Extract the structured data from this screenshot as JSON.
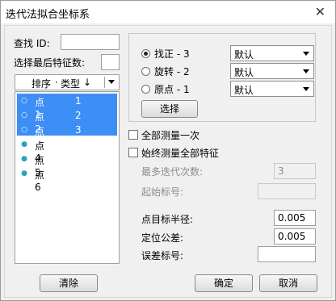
{
  "window": {
    "title": "迭代法拟合坐标系",
    "close": "✕"
  },
  "find": {
    "id_label": "查找 ID:",
    "id_value": "",
    "last_features_label": "选择最后特征数:",
    "last_features_value": ""
  },
  "list": {
    "header": {
      "col1": "排序",
      "col2": "类型",
      "sort_indicator": "↓"
    },
    "items": [
      {
        "name": "点1",
        "type": "1",
        "selected": true,
        "marker": "○"
      },
      {
        "name": "点2",
        "type": "2",
        "selected": true,
        "marker": "○"
      },
      {
        "name": "点3",
        "type": "3",
        "selected": true,
        "marker": "○"
      },
      {
        "name": "点4",
        "type": "",
        "selected": false,
        "marker": "●"
      },
      {
        "name": "点5",
        "type": "",
        "selected": false,
        "marker": "●"
      },
      {
        "name": "点6",
        "type": "",
        "selected": false,
        "marker": "●"
      }
    ]
  },
  "axes": {
    "options": [
      {
        "label": "找正 - 3",
        "selected": true,
        "combo": "默认"
      },
      {
        "label": "旋转 - 2",
        "selected": false,
        "combo": "默认"
      },
      {
        "label": "原点 - 1",
        "selected": false,
        "combo": "默认"
      }
    ],
    "select_button": "选择"
  },
  "measure_all_once": {
    "label": "全部测量一次",
    "checked": false
  },
  "always_measure_all": {
    "label": "始终测量全部特征",
    "checked": false
  },
  "max_iterations": {
    "label": "最多迭代次数:",
    "value": "3"
  },
  "start_label": {
    "label": "起始标号:",
    "value": ""
  },
  "target_radius": {
    "label": "点目标半径:",
    "value": "0.005"
  },
  "fixture_tolerance": {
    "label": "定位公差:",
    "value": "0.005"
  },
  "error_label": {
    "label": "误差标号:",
    "value": ""
  },
  "buttons": {
    "clear": "清除",
    "ok": "确定",
    "cancel": "取消"
  },
  "colors": {
    "selection": "#3d8ef5",
    "dialog_bg": "#f0f0f0"
  }
}
